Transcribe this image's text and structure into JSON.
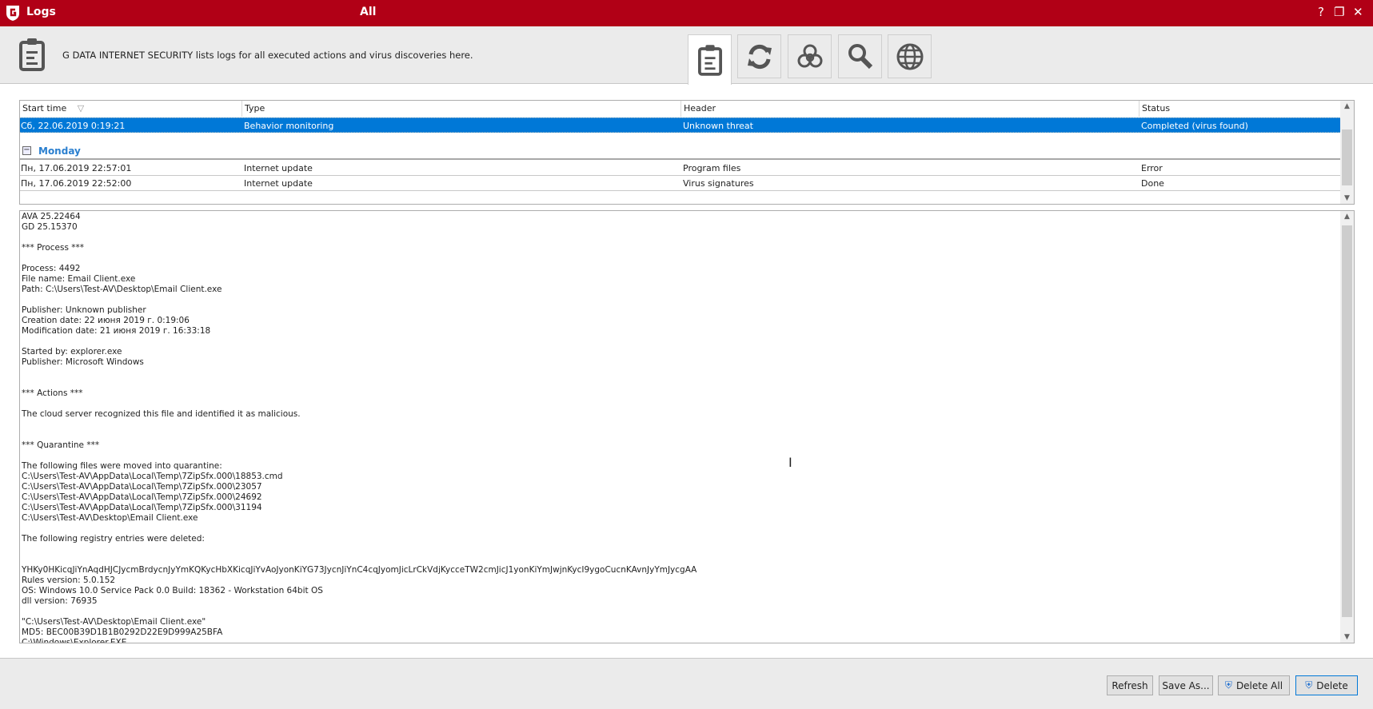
{
  "window": {
    "title": "Logs",
    "subtitle": "All",
    "help": "?",
    "restore": "❐",
    "close": "✕"
  },
  "header": {
    "description": "G DATA INTERNET SECURITY lists logs for all executed actions and virus discoveries here."
  },
  "toolbar": [
    {
      "name": "all-logs",
      "icon": "clipboard-icon",
      "active": true
    },
    {
      "name": "update",
      "icon": "refresh-icon"
    },
    {
      "name": "virus",
      "icon": "biohazard-icon"
    },
    {
      "name": "scan",
      "icon": "search-icon"
    },
    {
      "name": "web",
      "icon": "globe-icon"
    }
  ],
  "table": {
    "columns": [
      "Start time",
      "Type",
      "Header",
      "Status"
    ],
    "selected_row": {
      "start": "Сб, 22.06.2019 0:19:21",
      "type": "Behavior monitoring",
      "header": "Unknown threat",
      "status": "Completed (virus found)"
    },
    "group": {
      "label": "Monday",
      "toggle": "−"
    },
    "rows": [
      {
        "start": "Пн, 17.06.2019 22:57:01",
        "type": "Internet update",
        "header": "Program files",
        "status": "Error"
      },
      {
        "start": "Пн, 17.06.2019 22:52:00",
        "type": "Internet update",
        "header": "Virus signatures",
        "status": "Done"
      }
    ]
  },
  "details": {
    "lines": [
      "AVA 25.22464",
      "GD 25.15370",
      "",
      "*** Process ***",
      "",
      "Process: 4492",
      "File name: Email Client.exe",
      "Path: C:\\Users\\Test-AV\\Desktop\\Email Client.exe",
      "",
      "Publisher: Unknown publisher",
      "Creation date: 22 июня 2019 г. 0:19:06",
      "Modification date: 21 июня 2019 г. 16:33:18",
      "",
      "Started by: explorer.exe",
      "Publisher: Microsoft Windows",
      "",
      "",
      "*** Actions ***",
      "",
      "The cloud server recognized this file and identified it as malicious.",
      "",
      "",
      "*** Quarantine ***",
      "",
      "The following files were moved into quarantine:",
      "C:\\Users\\Test-AV\\AppData\\Local\\Temp\\7ZipSfx.000\\18853.cmd",
      "C:\\Users\\Test-AV\\AppData\\Local\\Temp\\7ZipSfx.000\\23057",
      "C:\\Users\\Test-AV\\AppData\\Local\\Temp\\7ZipSfx.000\\24692",
      "C:\\Users\\Test-AV\\AppData\\Local\\Temp\\7ZipSfx.000\\31194",
      "C:\\Users\\Test-AV\\Desktop\\Email Client.exe",
      "",
      "The following registry entries were deleted:",
      "",
      "",
      "YHKy0HKicqJiYnAqdHJCJycmBrdycnJyYmKQKycHbXKicqJiYvAoJyonKiYG73JycnJiYnC4cqJyomJicLrCkVdjKycceTW2cmJicJ1yonKiYmJwjnKycI9ygoCucnKAvnJyYmJycgAA",
      "Rules version: 5.0.152",
      "OS: Windows 10.0 Service Pack 0.0 Build: 18362 - Workstation 64bit OS",
      "dll version: 76935",
      "",
      "\"C:\\Users\\Test-AV\\Desktop\\Email Client.exe\"",
      "MD5: BEC00B39D1B1B0292D22E9D999A25BFA",
      "C:\\Windows\\Explorer.EXE"
    ]
  },
  "buttons": {
    "refresh": "Refresh",
    "save_as": "Save As...",
    "delete_all": "Delete All",
    "delete": "Delete"
  }
}
